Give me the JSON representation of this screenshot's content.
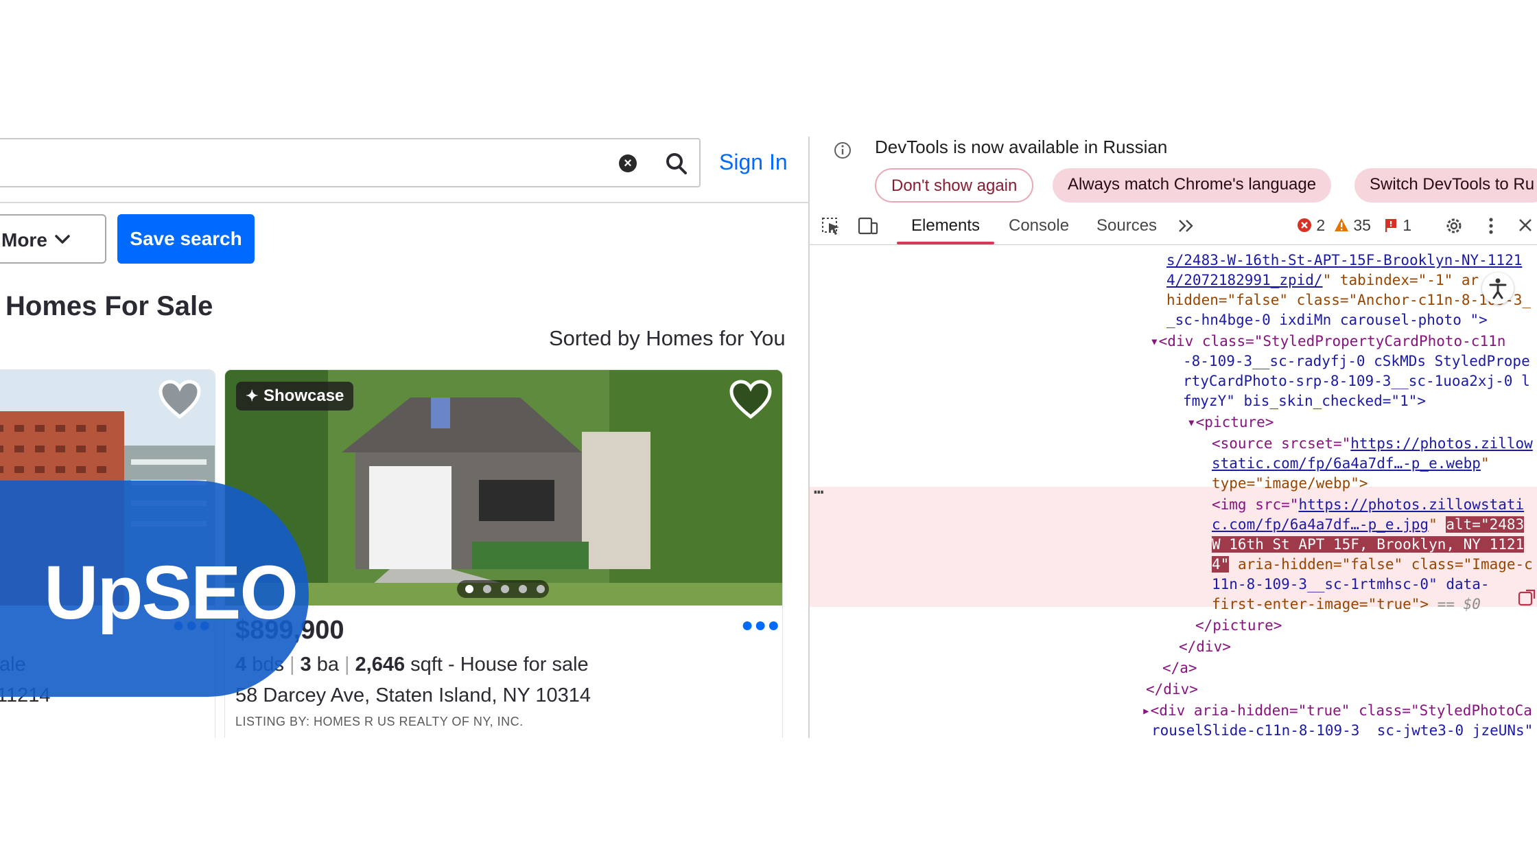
{
  "site": {
    "signin_label": "Sign In",
    "more_label": "More",
    "save_search_label": "Save search",
    "page_title": "Homes For Sale",
    "sort_label": "Sorted by Homes for You",
    "cards": [
      {
        "status_fragment": "ale",
        "zip_fragment": "11214"
      },
      {
        "badge": "Showcase",
        "price": "$899,900",
        "beds": "4",
        "beds_unit": "bds",
        "baths": "3",
        "baths_unit": "ba",
        "sqft": "2,646",
        "sqft_unit": "sqft",
        "type": "- House for sale",
        "address": "58 Darcey Ave, Staten Island, NY 10314",
        "listing_by": "LISTING BY: HOMES R US REALTY OF NY, INC.",
        "photo_count_dots": 5,
        "active_dot": 0
      }
    ]
  },
  "watermark": {
    "text": "UpSEO"
  },
  "devtools": {
    "infobar_message": "DevTools is now available in Russian",
    "dont_show_label": "Don't show again",
    "match_language_label": "Always match Chrome's language",
    "switch_label": "Switch DevTools to Ru",
    "tabs": [
      "Elements",
      "Console",
      "Sources"
    ],
    "active_tab": "Elements",
    "errors": "2",
    "warnings": "35",
    "issues": "1",
    "colors": {
      "accent": "#d63a5a",
      "tag": "#881280",
      "attr": "#994500",
      "value": "#1a1aa6",
      "selection": "#9f3a4b"
    },
    "code": {
      "l1": "s/2483-W-16th-St-APT-15F-Brooklyn-NY-1121",
      "l2a": "4/2072182991_zpid/",
      "l2b": "\" tabindex=\"-1\" ar",
      "l3": "hidden=\"false\" class=\"Anchor-c11n-8-109-3_",
      "l4": "_sc-hn4bge-0 ixdiMn carousel-photo \">",
      "l5": "<div class=\"StyledPropertyCardPhoto-c11n",
      "l6": "-8-109-3__sc-radyfj-0 cSkMDs StyledPrope",
      "l7": "rtyCardPhoto-srp-8-109-3__sc-1uoa2xj-0 l",
      "l8": "fmyzY\" bis_skin_checked=\"1\">",
      "l9": "<picture>",
      "l10a": "<source srcset=\"",
      "l10b": "https://photos.zillow",
      "l11a": "static.com/fp/6a4a7df…-p_e.webp",
      "l11b": "\"",
      "l12": "type=\"image/webp\">",
      "l13a": "<img src=\"",
      "l13b": "https://photos.zillowstati",
      "l14a": "c.com/fp/6a4a7df…-p_e.jpg",
      "l14b": "\" ",
      "l14c": "alt=\"2483",
      "l15": "W 16th St APT 15F, Brooklyn, NY 1121",
      "l16a": "4\"",
      "l16b": " aria-hidden=\"false\" class=\"Image-c",
      "l17": "11n-8-109-3__sc-1rtmhsc-0\" data-",
      "l18a": "first-enter-image=\"true\">",
      "l18b": " == $0",
      "l19": "</picture>",
      "l20": "</div>",
      "l21": "</a>",
      "l22": "</div>",
      "l23": "<div aria-hidden=\"true\" class=\"StyledPhotoCa",
      "l24": "rouselSlide-c11n-8-109-3__sc-jwte3-0 jzeUNs\""
    }
  }
}
